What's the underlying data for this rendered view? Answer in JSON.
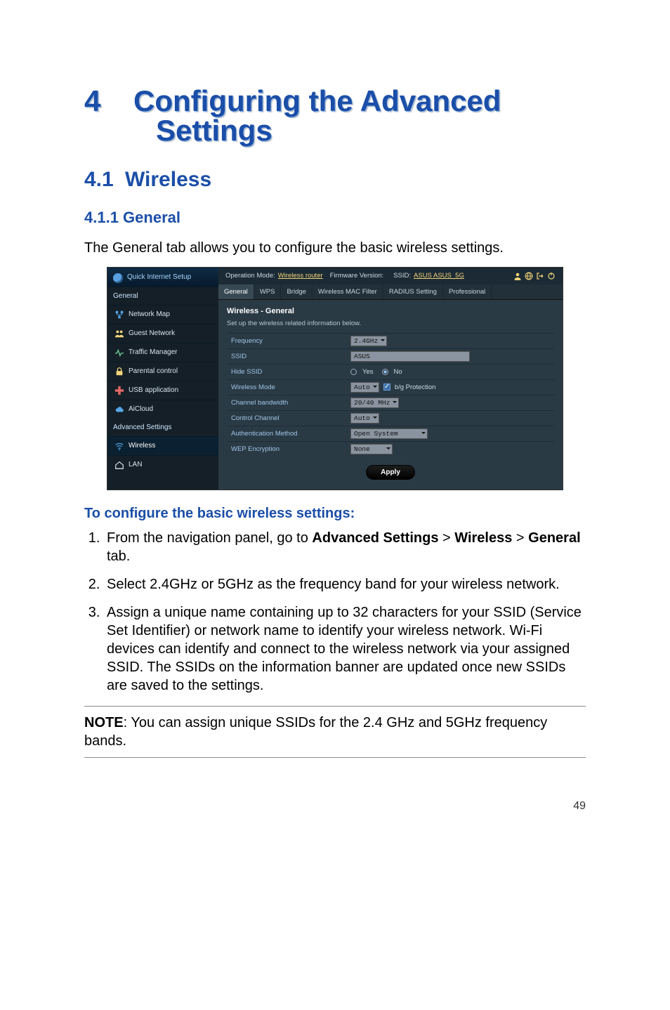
{
  "chapter": {
    "number": "4",
    "title_line1": "Configuring the Advanced",
    "title_line2": "Settings"
  },
  "h2": {
    "number": "4.1",
    "title": "Wireless"
  },
  "h3": {
    "title": "4.1.1 General"
  },
  "intro": "The General tab allows you to configure the basic wireless settings.",
  "subhead": "To configure the basic wireless settings:",
  "steps": {
    "s1_a": "From the navigation panel, go to ",
    "s1_b": "Advanced Settings",
    "s1_c": " > ",
    "s1_d": "Wireless",
    "s1_e": " > ",
    "s1_f": "General",
    "s1_g": " tab.",
    "s2": "Select 2.4GHz or 5GHz as the frequency band for your wireless network.",
    "s3": "Assign a unique name containing up to 32 characters for your SSID (Service Set Identifier) or network name to identify your wireless network. Wi-Fi devices can identify and connect to the wireless network via your assigned SSID. The SSIDs on the information banner are updated once new SSIDs are saved to the settings."
  },
  "note": {
    "label": "NOTE",
    "text": ":   You can assign unique SSIDs for the 2.4 GHz and 5GHz frequency bands."
  },
  "page_number": "49",
  "screenshot": {
    "qis": "Quick Internet Setup",
    "section_general": "General",
    "side": {
      "network_map": "Network Map",
      "guest_network": "Guest Network",
      "traffic_manager": "Traffic Manager",
      "parental_control": "Parental control",
      "usb_app": "USB application",
      "aicloud": "AiCloud"
    },
    "section_adv": "Advanced Settings",
    "side_adv": {
      "wireless": "Wireless",
      "lan": "LAN"
    },
    "top": {
      "opmode_label": "Operation Mode: ",
      "opmode_link": "Wireless router",
      "fw": "Firmware Version:",
      "ssid_label": "SSID: ",
      "ssid_link": "ASUS ASUS_5G"
    },
    "tabs": {
      "general": "General",
      "wps": "WPS",
      "bridge": "Bridge",
      "mac": "Wireless MAC Filter",
      "radius": "RADIUS Setting",
      "pro": "Professional"
    },
    "panel": {
      "title": "Wireless - General",
      "sub": "Set up the wireless related information below.",
      "rows": {
        "frequency": {
          "label": "Frequency",
          "value": "2.4GHz"
        },
        "ssid": {
          "label": "SSID",
          "value": "ASUS"
        },
        "hide": {
          "label": "Hide SSID",
          "yes": "Yes",
          "no": "No"
        },
        "mode": {
          "label": "Wireless Mode",
          "value": "Auto",
          "bg": "b/g Protection"
        },
        "bw": {
          "label": "Channel bandwidth",
          "value": "20/40 MHz"
        },
        "channel": {
          "label": "Control Channel",
          "value": "Auto"
        },
        "auth": {
          "label": "Authentication Method",
          "value": "Open System"
        },
        "wep": {
          "label": "WEP Encryption",
          "value": "None"
        }
      },
      "apply": "Apply"
    }
  }
}
